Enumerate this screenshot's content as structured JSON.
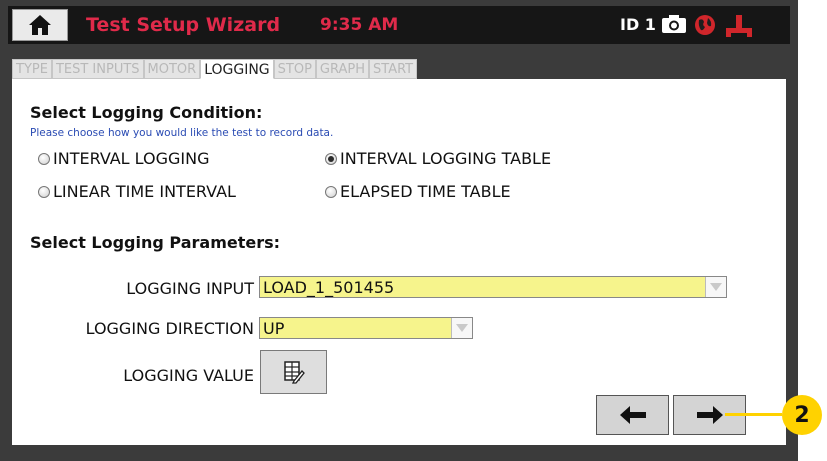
{
  "header": {
    "title": "Test Setup Wizard",
    "time": "9:35 AM",
    "id_label": "ID 1",
    "icons": [
      "home-icon",
      "camera-icon",
      "network-globe-icon",
      "usb-connection-icon"
    ],
    "colors": {
      "title": "#e02a4a",
      "bar": "#161616",
      "frame": "#3b3b3b"
    }
  },
  "tabs": [
    {
      "label": "TYPE",
      "active": false
    },
    {
      "label": "TEST INPUTS",
      "active": false
    },
    {
      "label": "MOTOR",
      "active": false
    },
    {
      "label": "LOGGING",
      "active": true
    },
    {
      "label": "STOP",
      "active": false
    },
    {
      "label": "GRAPH",
      "active": false
    },
    {
      "label": "START",
      "active": false
    }
  ],
  "condition": {
    "heading": "Select Logging Condition:",
    "help": "Please choose how you would like the test to record data.",
    "options": [
      {
        "label": "INTERVAL LOGGING",
        "selected": false
      },
      {
        "label": "INTERVAL LOGGING TABLE",
        "selected": true
      },
      {
        "label": "LINEAR TIME INTERVAL",
        "selected": false
      },
      {
        "label": "ELAPSED TIME TABLE",
        "selected": false
      }
    ]
  },
  "parameters": {
    "heading": "Select Logging Parameters:",
    "input_label": "LOGGING INPUT",
    "input_value": "LOAD_1_501455",
    "direction_label": "LOGGING DIRECTION",
    "direction_value": "UP",
    "value_label": "LOGGING VALUE",
    "value_button_icon": "table-edit-icon",
    "field_color": "#f6f48c"
  },
  "nav": {
    "back_icon": "arrow-left-icon",
    "next_icon": "arrow-right-icon"
  },
  "callout": {
    "number": "2",
    "color": "#ffd200"
  }
}
